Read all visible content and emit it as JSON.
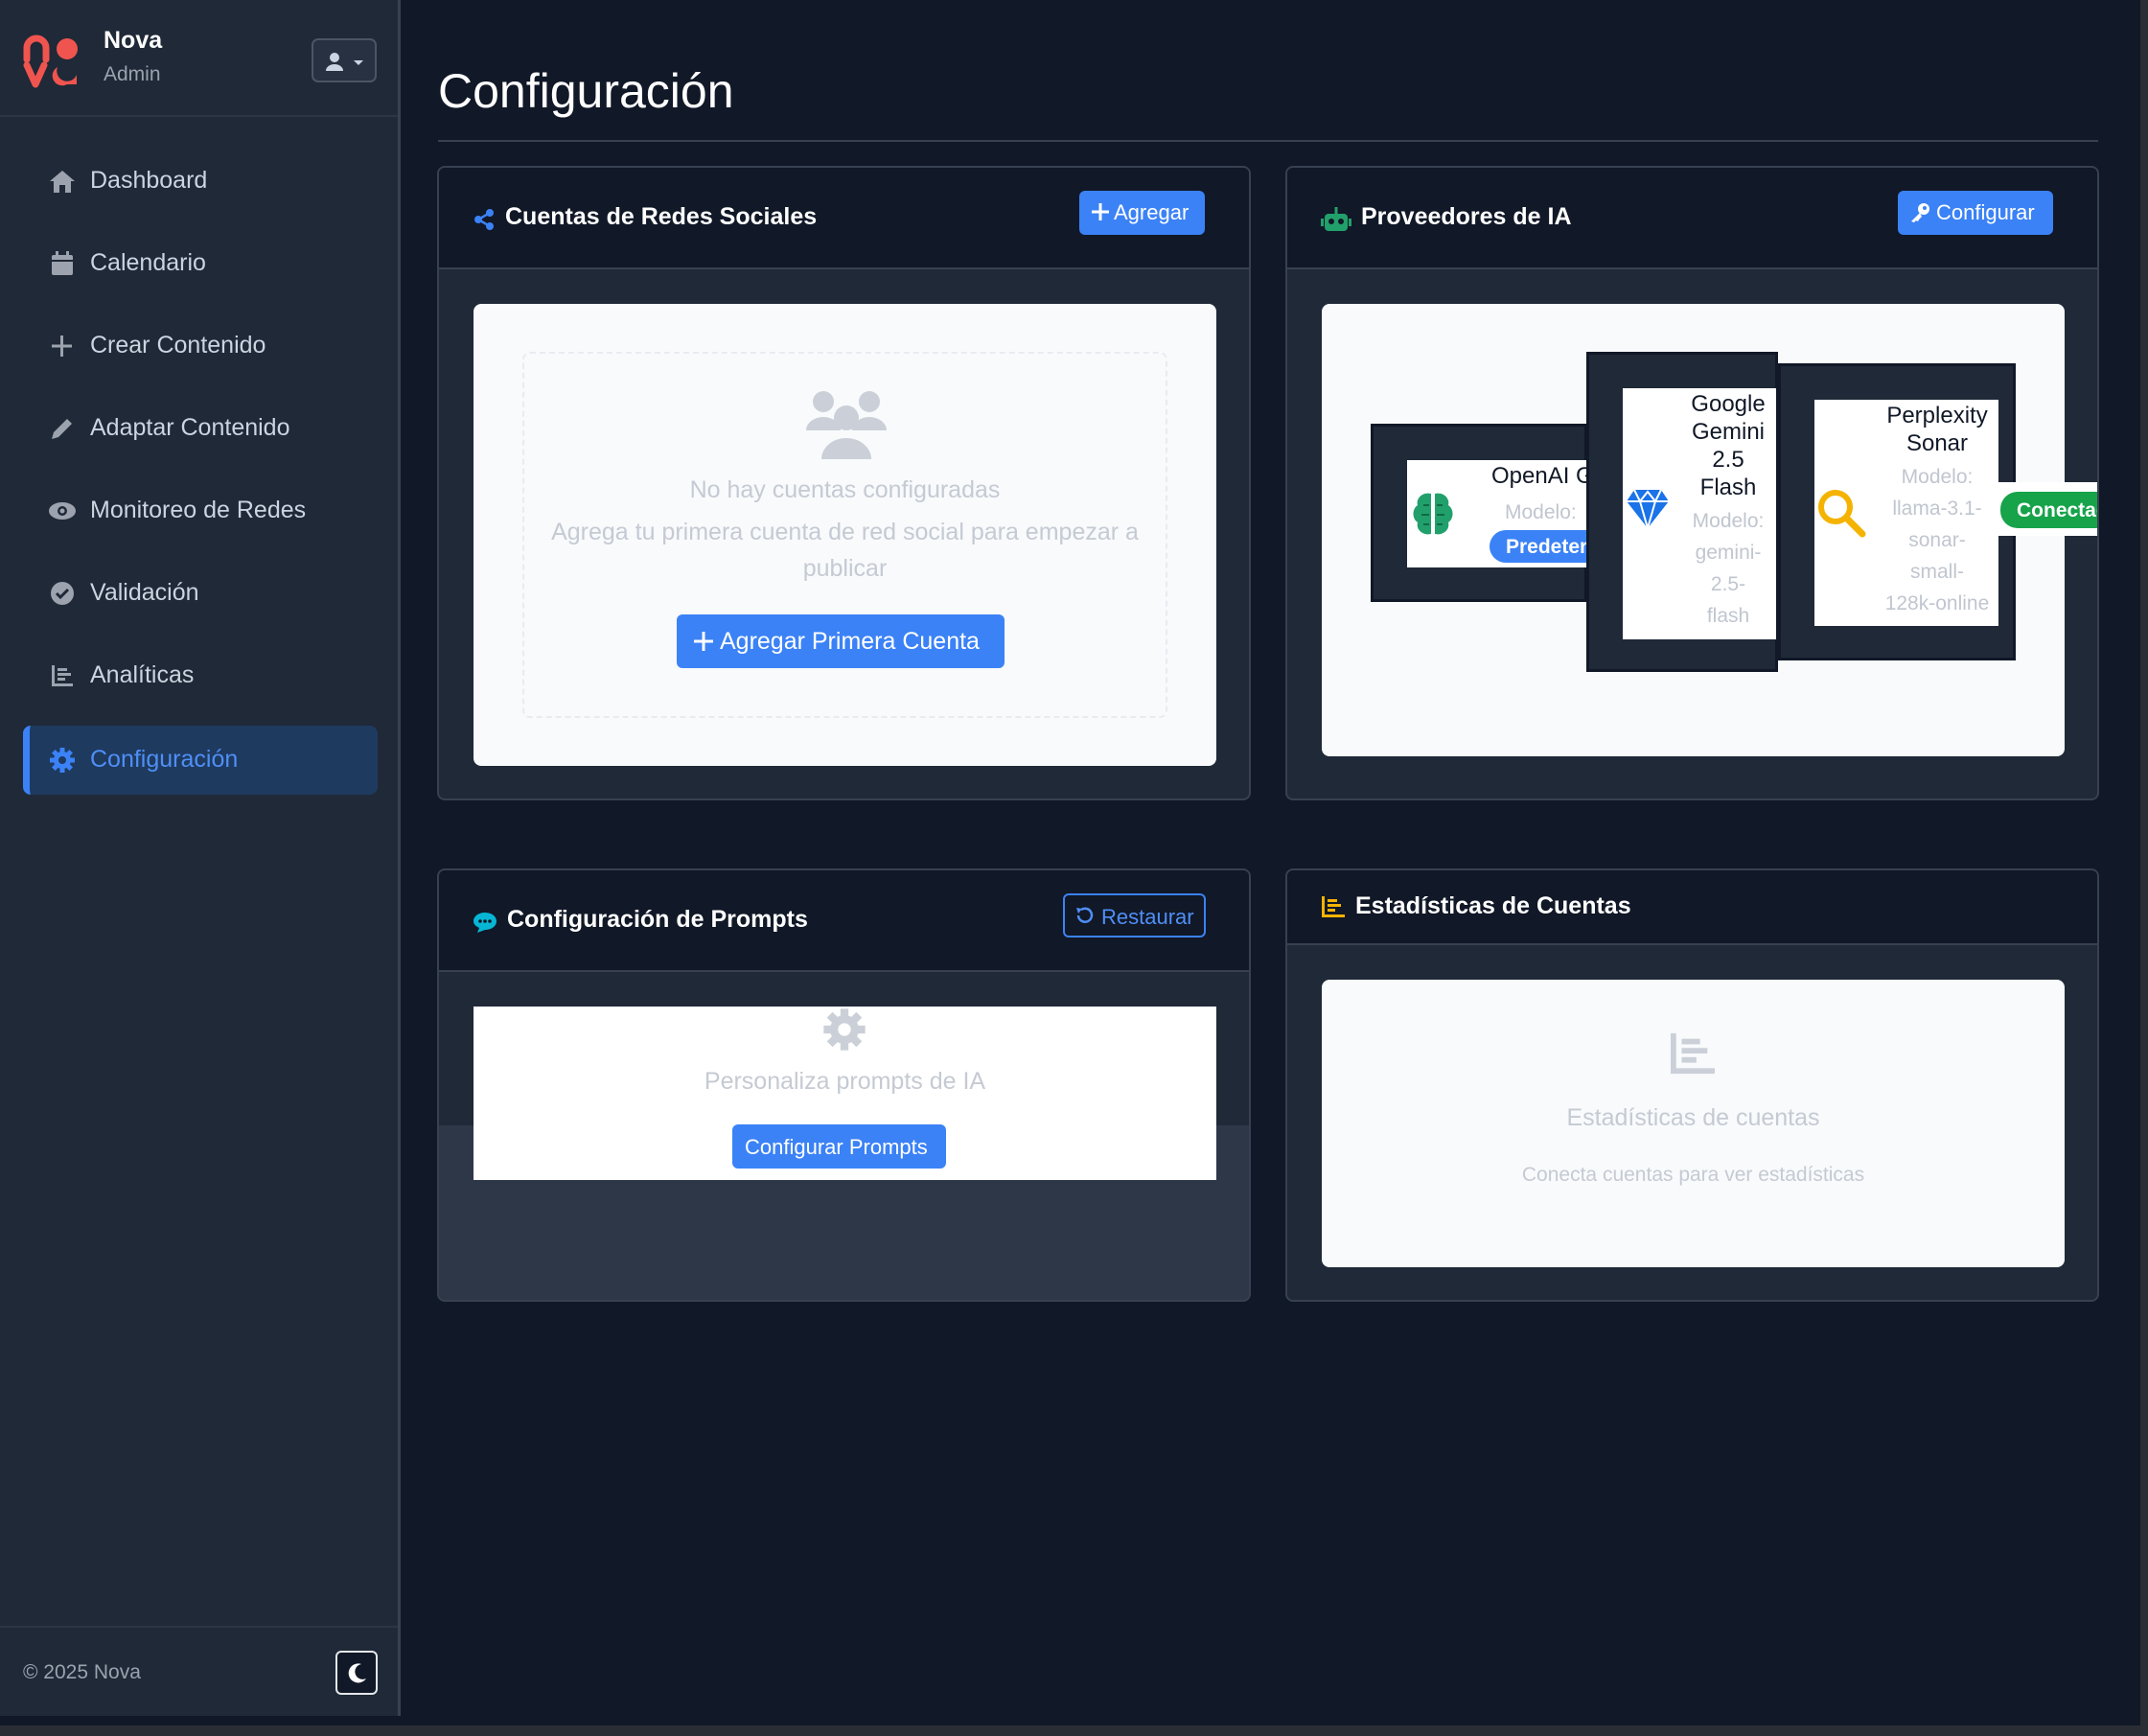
{
  "brand": {
    "name": "Nova",
    "role": "Admin"
  },
  "nav": [
    {
      "label": "Dashboard",
      "icon": "home-icon"
    },
    {
      "label": "Calendario",
      "icon": "calendar-icon"
    },
    {
      "label": "Crear Contenido",
      "icon": "plus-icon"
    },
    {
      "label": "Adaptar Contenido",
      "icon": "pencil-icon"
    },
    {
      "label": "Monitoreo de Redes",
      "icon": "eye-icon"
    },
    {
      "label": "Validación",
      "icon": "check-circle-icon"
    },
    {
      "label": "Analíticas",
      "icon": "chart-icon"
    },
    {
      "label": "Configuración",
      "icon": "gear-icon",
      "active": true
    }
  ],
  "footer": {
    "copyright": "© 2025 Nova"
  },
  "page": {
    "title": "Configuración"
  },
  "social": {
    "title": "Cuentas de Redes Sociales",
    "add_button": "Agregar",
    "empty_title": "No hay cuentas configuradas",
    "empty_desc_line1": "Agrega tu primera cuenta de red social para empezar a",
    "empty_desc_line2": "publicar",
    "first_button": "Agregar Primera Cuenta"
  },
  "ai": {
    "title": "Proveedores de IA",
    "configure_button": "Configurar",
    "providers": [
      {
        "name": "OpenAI G",
        "model_lines": [
          "Modelo:"
        ],
        "badge": "Predeter",
        "icon": "brain-icon"
      },
      {
        "name_lines": [
          "Google",
          "Gemini",
          "2.5",
          "Flash"
        ],
        "model_lines": [
          "Modelo:",
          "gemini-",
          "2.5-",
          "flash"
        ],
        "icon": "gem-icon"
      },
      {
        "name_lines": [
          "Perplexity",
          "Sonar"
        ],
        "model_lines": [
          "Modelo:",
          "llama-3.1-",
          "sonar-",
          "small-",
          "128k-online"
        ],
        "badge": "Conectado",
        "icon": "magnifier-icon"
      }
    ]
  },
  "prompts": {
    "title": "Configuración de Prompts",
    "restore_button": "Restaurar",
    "desc": "Personaliza prompts de IA",
    "configure_button": "Configurar Prompts"
  },
  "stats": {
    "title": "Estadísticas de Cuentas",
    "empty_title": "Estadísticas de cuentas",
    "empty_desc": "Conecta cuentas para ver estadísticas"
  },
  "colors": {
    "accent": "#3b82f6",
    "success": "#16a34a",
    "logo": "#f0544f",
    "ai_icon": "#22a06b",
    "stats_icon": "#f5b301"
  }
}
